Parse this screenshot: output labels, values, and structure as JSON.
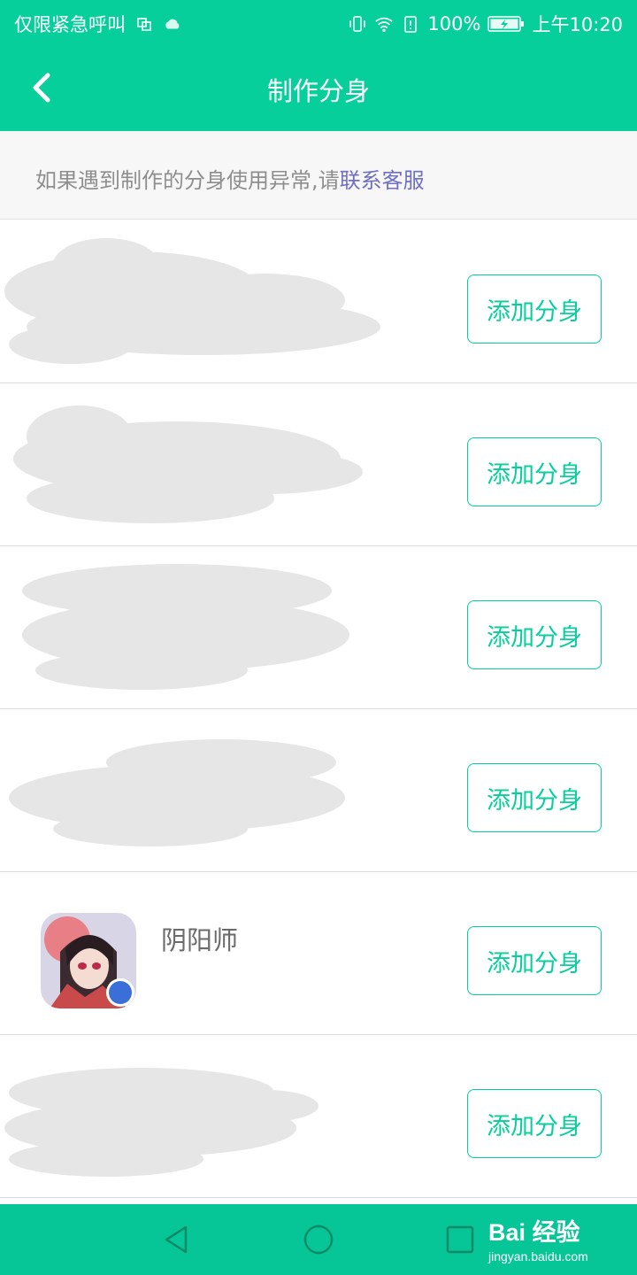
{
  "status_bar": {
    "carrier": "仅限紧急呼叫",
    "battery": "100%",
    "time": "上午10:20"
  },
  "header": {
    "title": "制作分身"
  },
  "notice": {
    "text": "如果遇到制作的分身使用异常,请",
    "link": "联系客服"
  },
  "apps": [
    {
      "name": "",
      "button": "添加分身"
    },
    {
      "name": "",
      "button": "添加分身"
    },
    {
      "name": "",
      "button": "添加分身"
    },
    {
      "name": "",
      "button": "添加分身"
    },
    {
      "name": "阴阳师",
      "button": "添加分身"
    },
    {
      "name": "",
      "button": "添加分身"
    }
  ],
  "watermark": {
    "brand": "Bai 经验",
    "url": "jingyan.baidu.com"
  },
  "colors": {
    "accent": "#06cf9c",
    "link": "#6f6fc4",
    "redaction": "#e6e6e6"
  }
}
